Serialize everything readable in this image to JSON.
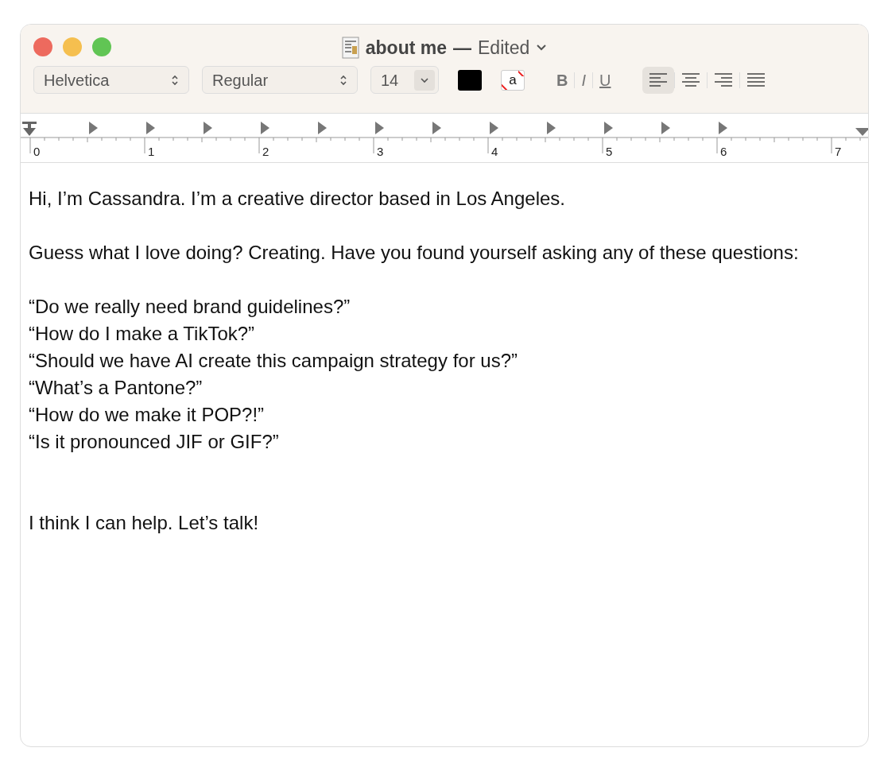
{
  "window": {
    "title": "about me",
    "separator": "—",
    "status": "Edited"
  },
  "toolbar": {
    "font": "Helvetica",
    "style": "Regular",
    "size": "14",
    "highlight_sample": "a",
    "bold": "B",
    "italic": "I",
    "underline": "U",
    "alignments": [
      {
        "kind": "left",
        "selected": true
      },
      {
        "kind": "center",
        "selected": false
      },
      {
        "kind": "right",
        "selected": false
      },
      {
        "kind": "justify",
        "selected": false
      }
    ]
  },
  "ruler": {
    "labels": [
      "0",
      "1",
      "2",
      "3",
      "4",
      "5",
      "6",
      "7"
    ]
  },
  "document": {
    "paragraphs": [
      {
        "kind": "normal",
        "lines": [
          "Hi, I’m Cassandra. I’m a creative director based in Los Angeles."
        ]
      },
      {
        "kind": "normal",
        "lines": [
          "Guess what I love doing? Creating. Have you found yourself asking any of these questions:"
        ]
      },
      {
        "kind": "normal",
        "lines": [
          "“Do we really need brand guidelines?”",
          "“How do I make a TikTok?”",
          "“Should we have AI create this campaign strategy for us?”",
          "“What’s a Pantone?”",
          "“How do we make it POP?!”",
          "“Is it pronounced JIF or GIF?”"
        ]
      },
      {
        "kind": "closing",
        "lines": [
          "I think I can help. Let’s talk!"
        ]
      }
    ]
  }
}
